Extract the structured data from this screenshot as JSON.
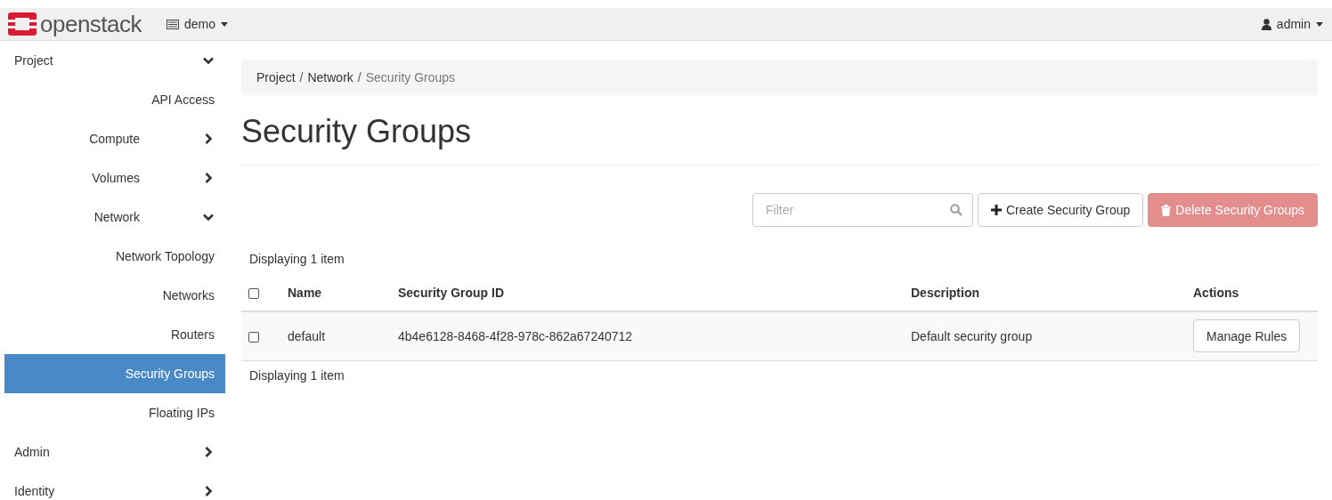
{
  "topbar": {
    "brand": "openstack",
    "project": "demo",
    "user": "admin"
  },
  "sidebar": {
    "items": [
      {
        "label": "Project",
        "expanded": true,
        "selected": false,
        "children": [
          {
            "label": "API Access",
            "selected": false
          },
          {
            "label": "Compute",
            "expanded": false,
            "selected": false
          },
          {
            "label": "Volumes",
            "expanded": false,
            "selected": false
          },
          {
            "label": "Network",
            "expanded": true,
            "selected": false,
            "children": [
              {
                "label": "Network Topology",
                "selected": false
              },
              {
                "label": "Networks",
                "selected": false
              },
              {
                "label": "Routers",
                "selected": false
              },
              {
                "label": "Security Groups",
                "selected": true
              },
              {
                "label": "Floating IPs",
                "selected": false
              }
            ]
          }
        ]
      },
      {
        "label": "Admin",
        "expanded": false,
        "selected": false
      },
      {
        "label": "Identity",
        "expanded": false,
        "selected": false
      }
    ]
  },
  "breadcrumb": [
    "Project",
    "Network",
    "Security Groups"
  ],
  "breadcrumb_separator": "/",
  "title": "Security Groups",
  "toolbar": {
    "filter": {
      "placeholder": "Filter"
    },
    "create_button": "Create Security Group",
    "delete_button": {
      "label": "Delete Security Groups",
      "disabled": true
    }
  },
  "summary_top": "Displaying 1 item",
  "table": {
    "columns": [
      "Name",
      "Security Group ID",
      "Description",
      "Actions"
    ],
    "header_checked": false,
    "rows": [
      {
        "checked": false,
        "name": "default",
        "id": "4b4e6128-8468-4f28-978c-862a67240712",
        "description": "Default security group",
        "action": "Manage Rules"
      }
    ]
  },
  "summary_bottom": "Displaying 1 item"
}
